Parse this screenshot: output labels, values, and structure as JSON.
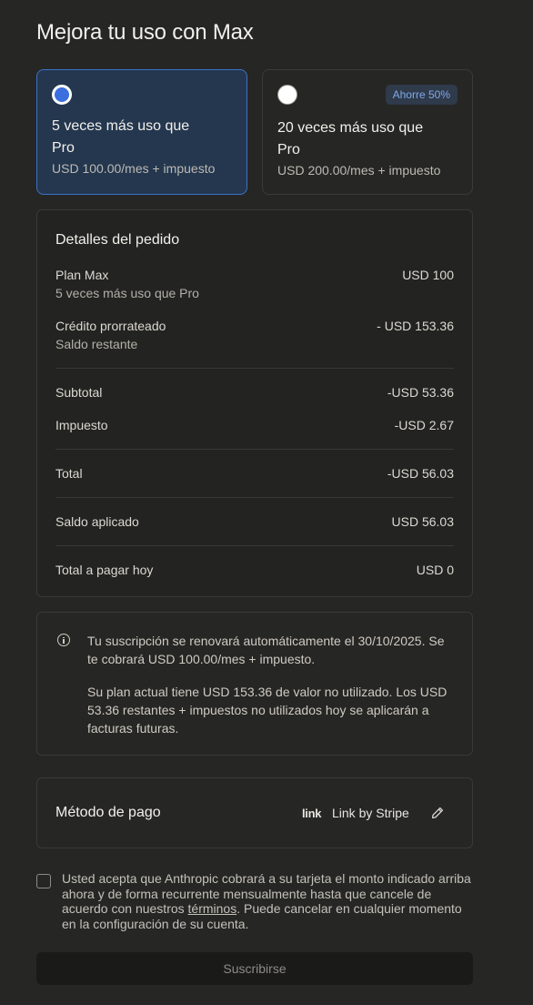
{
  "page": {
    "title": "Mejora tu uso con Max"
  },
  "plans": [
    {
      "title": "5 veces más uso que Pro",
      "price": "USD 100.00/mes + impuesto",
      "selected": true
    },
    {
      "title": "20 veces más uso que Pro",
      "price": "USD 200.00/mes + impuesto",
      "selected": false,
      "badge": "Ahorre 50%"
    }
  ],
  "order": {
    "heading": "Detalles del pedido",
    "plan_label": "Plan Max",
    "plan_sub": "5 veces más uso que Pro",
    "plan_amount": "USD 100",
    "credit_label": "Crédito prorrateado",
    "credit_sub": "Saldo restante",
    "credit_amount": "- USD 153.36",
    "subtotal_label": "Subtotal",
    "subtotal_amount": "-USD 53.36",
    "tax_label": "Impuesto",
    "tax_amount": "-USD 2.67",
    "total_label": "Total",
    "total_amount": "-USD 56.03",
    "balance_label": "Saldo aplicado",
    "balance_amount": "USD 56.03",
    "due_label": "Total a pagar hoy",
    "due_amount": "USD 0"
  },
  "info": {
    "p1": "Tu suscripción se renovará automáticamente el 30/10/2025. Se te cobrará USD 100.00/mes + impuesto.",
    "p2": "Su plan actual tiene USD 153.36 de valor no utilizado. Los USD 53.36 restantes + impuestos no utilizados hoy se aplicarán a facturas futuras."
  },
  "payment": {
    "label": "Método de pago",
    "logo": "link",
    "method": "Link by Stripe"
  },
  "consent": {
    "before": "Usted acepta que Anthropic cobrará a su tarjeta el monto indicado arriba ahora y de forma recurrente mensualmente hasta que cancele de acuerdo con nuestros ",
    "terms": "términos",
    "after": ". Puede cancelar en cualquier momento en la configuración de su cuenta."
  },
  "subscribe_label": "Suscribirse",
  "colors": {
    "accent": "#3b6fe0",
    "selected_card": "#24374f",
    "badge_text": "#7fa9e8"
  },
  "icons": [
    "info-icon",
    "pencil-icon",
    "link-logo"
  ]
}
